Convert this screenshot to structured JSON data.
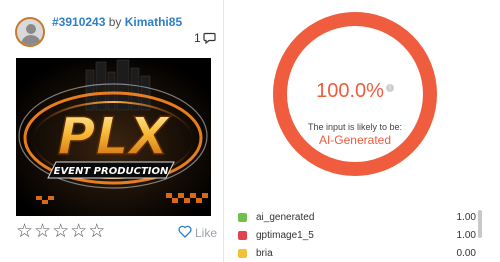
{
  "post": {
    "id_link": "#3910243",
    "by_text": "by",
    "username": "Kimathi85",
    "comment_count": "1",
    "like_label": "Like",
    "rating_stars": 5,
    "artwork": {
      "logo_text": "PLX",
      "subtitle": "EVENT PRODUCTION"
    }
  },
  "detector": {
    "percent": "100.0%",
    "likely_text": "The input is likely to be:",
    "verdict": "AI-Generated",
    "gauge_fraction": 1.0,
    "accent": "#ef5c3e",
    "rows": [
      {
        "label": "ai_generated",
        "score": "1.00",
        "color": "#6cc24a"
      },
      {
        "label": "gptimage1_5",
        "score": "1.00",
        "color": "#e0424e"
      },
      {
        "label": "bria",
        "score": "0.00",
        "color": "#f2c03b"
      }
    ]
  },
  "icons": {
    "comment": "comment-icon",
    "like": "heart-icon",
    "info": "info-icon",
    "star": "star-outline-icon"
  }
}
